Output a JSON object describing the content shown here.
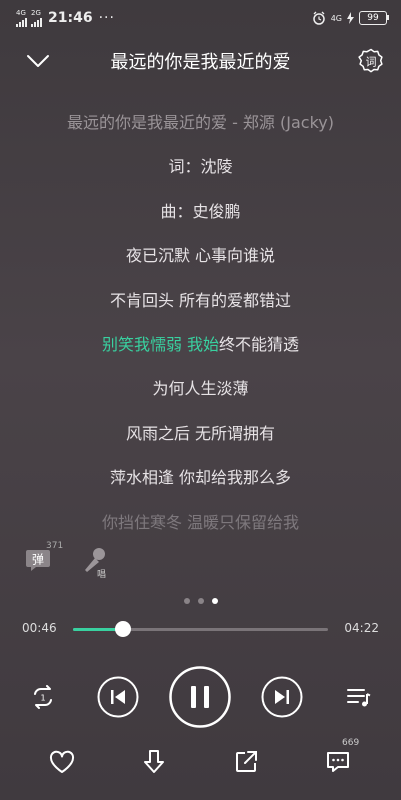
{
  "status_bar": {
    "network1": "4G",
    "network2": "2G",
    "time": "21:46",
    "more": "···",
    "network_right": "4G",
    "battery": "99"
  },
  "header": {
    "song_title": "最远的你是我最近的爱",
    "lyrics_button_label": "词"
  },
  "lyrics": [
    {
      "text": "最远的你是我最近的爱 - 郑源 (Jacky)",
      "style": "dim"
    },
    {
      "text": "词：沈陵",
      "style": "normal"
    },
    {
      "text": "曲：史俊鹏",
      "style": "normal"
    },
    {
      "text": "夜已沉默 心事向谁说",
      "style": "normal"
    },
    {
      "text": "不肯回头 所有的爱都错过",
      "style": "normal"
    },
    {
      "text": "为何人生淡薄",
      "style": "normal"
    },
    {
      "text": "风雨之后 无所谓拥有",
      "style": "normal"
    },
    {
      "text": "萍水相逢 你却给我那么多",
      "style": "normal"
    },
    {
      "text": "你挡住寒冬 温暖只保留给我",
      "style": "fade"
    }
  ],
  "current_line": {
    "highlighted": "别笑我懦弱 我始",
    "rest": "终不能猜透"
  },
  "danmu": {
    "label": "弹",
    "count": "371"
  },
  "sing": {
    "label": "唱"
  },
  "player": {
    "current_time": "00:46",
    "total_time": "04:22",
    "progress": 0.195,
    "accent_color": "#39d1a0"
  },
  "comments": {
    "count": "669"
  }
}
